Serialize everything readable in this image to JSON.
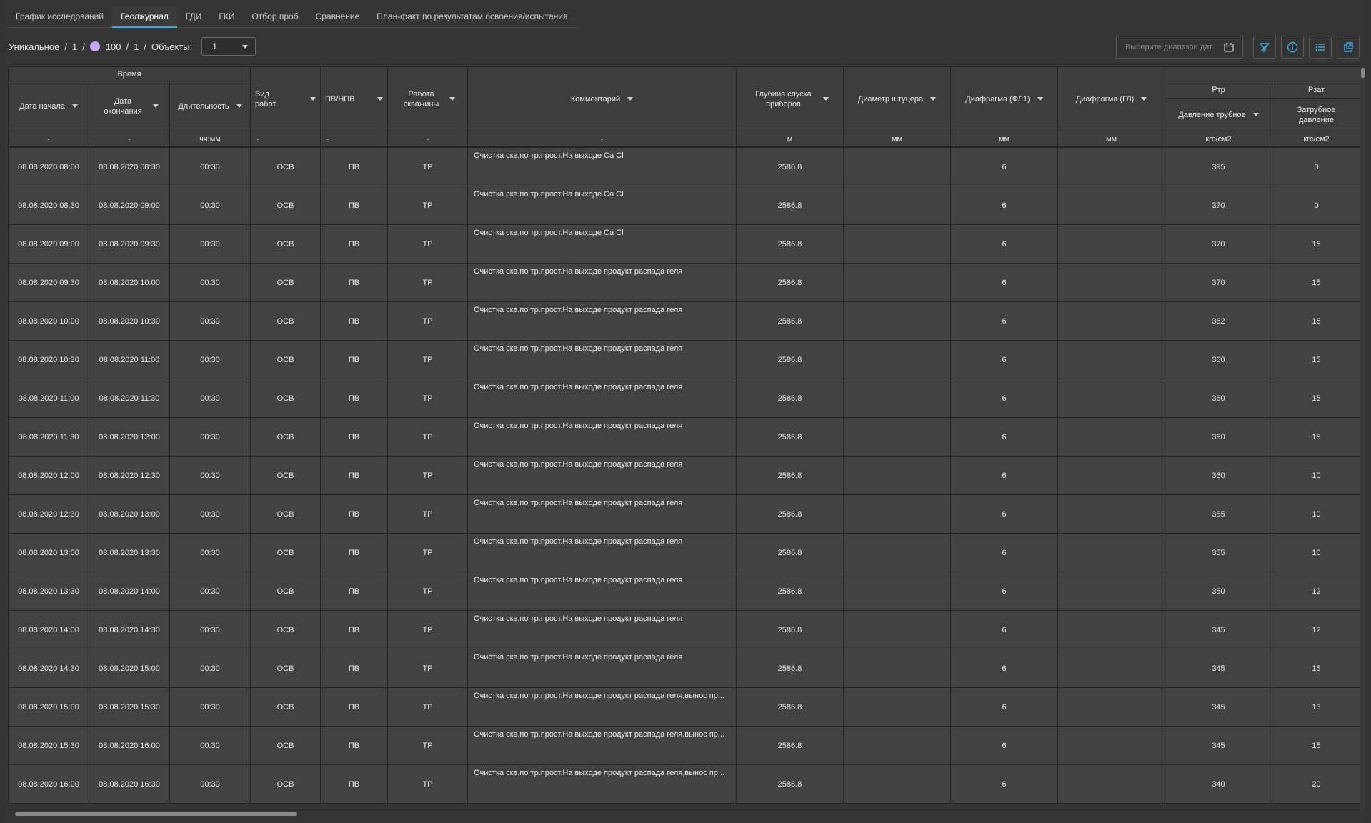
{
  "tabs": [
    {
      "label": "График исследований",
      "active": false
    },
    {
      "label": "Геолжурнал",
      "active": true
    },
    {
      "label": "ГДИ",
      "active": false
    },
    {
      "label": "ГКИ",
      "active": false
    },
    {
      "label": "Отбор проб",
      "active": false
    },
    {
      "label": "Сравнение",
      "active": false
    },
    {
      "label": "План-факт по результатам освоения/испытания",
      "active": false
    }
  ],
  "toolbar": {
    "unique_label": "Уникальное",
    "sep": "/",
    "val1": "1",
    "status_value": "100",
    "val2": "1",
    "objects_label": "Объекты:",
    "objects_value": "1",
    "date_placeholder": "Выберите диапазон дат"
  },
  "table": {
    "group_time": "Время",
    "group_ptr": "Ртр",
    "group_pzat": "Рзат",
    "headers": {
      "start": "Дата начала",
      "end": "Дата окончания",
      "duration": "Длительность",
      "work_type": "Вид работ",
      "pv": "ПВ/НПВ",
      "well_work": "Работа скважины",
      "comment": "Комментарий",
      "depth": "Глубина спуска приборов",
      "choke": "Диаметр штуцера",
      "diaph_fl": "Диафрагма (ФЛ1)",
      "diaph_gl": "Диафрагма (ГЛ)",
      "tube_pressure": "Давление трубное",
      "annular_pressure": "Затрубное давление"
    },
    "units": [
      "-",
      "-",
      "чч:мм",
      "-",
      "-",
      "-",
      "-",
      "м",
      "мм",
      "мм",
      "мм",
      "кгс/см2",
      "кгс/см2"
    ],
    "rows": [
      [
        "08.08.2020 08:00",
        "08.08.2020 08:30",
        "00:30",
        "ОСВ",
        "ПВ",
        "ТР",
        "Очистка скв.по тр.прост.На выходе Са Cl",
        "2586.8",
        "",
        "6",
        "",
        "395",
        "0"
      ],
      [
        "08.08.2020 08:30",
        "08.08.2020 09:00",
        "00:30",
        "ОСВ",
        "ПВ",
        "ТР",
        "Очистка скв.по тр.прост.На выходе Са Cl",
        "2586.8",
        "",
        "6",
        "",
        "370",
        "0"
      ],
      [
        "08.08.2020 09:00",
        "08.08.2020 09:30",
        "00:30",
        "ОСВ",
        "ПВ",
        "ТР",
        "Очистка скв.по тр.прост.На выходе Са Cl",
        "2586.8",
        "",
        "6",
        "",
        "370",
        "15"
      ],
      [
        "08.08.2020 09:30",
        "08.08.2020 10:00",
        "00:30",
        "ОСВ",
        "ПВ",
        "ТР",
        "Очистка скв.по тр.прост.На выходе продукт распада геля",
        "2586.8",
        "",
        "6",
        "",
        "370",
        "15"
      ],
      [
        "08.08.2020 10:00",
        "08.08.2020 10:30",
        "00:30",
        "ОСВ",
        "ПВ",
        "ТР",
        "Очистка скв.по тр.прост.На выходе продукт распада геля",
        "2586.8",
        "",
        "6",
        "",
        "362",
        "15"
      ],
      [
        "08.08.2020 10:30",
        "08.08.2020 11:00",
        "00:30",
        "ОСВ",
        "ПВ",
        "ТР",
        "Очистка скв.по тр.прост.На выходе продукт распада геля",
        "2586.8",
        "",
        "6",
        "",
        "360",
        "15"
      ],
      [
        "08.08.2020 11:00",
        "08.08.2020 11:30",
        "00:30",
        "ОСВ",
        "ПВ",
        "ТР",
        "Очистка скв.по тр.прост.На выходе продукт распада геля",
        "2586.8",
        "",
        "6",
        "",
        "360",
        "15"
      ],
      [
        "08.08.2020 11:30",
        "08.08.2020 12:00",
        "00:30",
        "ОСВ",
        "ПВ",
        "ТР",
        "Очистка скв.по тр.прост.На выходе продукт распада геля",
        "2586.8",
        "",
        "6",
        "",
        "360",
        "15"
      ],
      [
        "08.08.2020 12:00",
        "08.08.2020 12:30",
        "00:30",
        "ОСВ",
        "ПВ",
        "ТР",
        "Очистка скв.по тр.прост.На выходе продукт распада геля",
        "2586.8",
        "",
        "6",
        "",
        "360",
        "10"
      ],
      [
        "08.08.2020 12:30",
        "08.08.2020 13:00",
        "00:30",
        "ОСВ",
        "ПВ",
        "ТР",
        "Очистка скв.по тр.прост.На выходе продукт распада геля",
        "2586.8",
        "",
        "6",
        "",
        "355",
        "10"
      ],
      [
        "08.08.2020 13:00",
        "08.08.2020 13:30",
        "00:30",
        "ОСВ",
        "ПВ",
        "ТР",
        "Очистка скв.по тр.прост.На выходе продукт распада геля",
        "2586.8",
        "",
        "6",
        "",
        "355",
        "10"
      ],
      [
        "08.08.2020 13:30",
        "08.08.2020 14:00",
        "00:30",
        "ОСВ",
        "ПВ",
        "ТР",
        "Очистка скв.по тр.прост.На выходе продукт распада геля",
        "2586.8",
        "",
        "6",
        "",
        "350",
        "12"
      ],
      [
        "08.08.2020 14:00",
        "08.08.2020 14:30",
        "00:30",
        "ОСВ",
        "ПВ",
        "ТР",
        "Очистка скв.по тр.прост.На выходе продукт распада геля",
        "2586.8",
        "",
        "6",
        "",
        "345",
        "12"
      ],
      [
        "08.08.2020 14:30",
        "08.08.2020 15:00",
        "00:30",
        "ОСВ",
        "ПВ",
        "ТР",
        "Очистка скв.по тр.прост.На выходе продукт распада геля",
        "2586.8",
        "",
        "6",
        "",
        "345",
        "15"
      ],
      [
        "08.08.2020 15:00",
        "08.08.2020 15:30",
        "00:30",
        "ОСВ",
        "ПВ",
        "ТР",
        "Очистка скв.по тр.прост.На выходе продукт распада геля,вынос пр...",
        "2586.8",
        "",
        "6",
        "",
        "345",
        "13"
      ],
      [
        "08.08.2020 15:30",
        "08.08.2020 16:00",
        "00:30",
        "ОСВ",
        "ПВ",
        "ТР",
        "Очистка скв.по тр.прост.На выходе продукт распада геля,вынос пр...",
        "2586.8",
        "",
        "6",
        "",
        "345",
        "15"
      ],
      [
        "08.08.2020 16:00",
        "08.08.2020 16:30",
        "00:30",
        "ОСВ",
        "ПВ",
        "ТР",
        "Очистка скв.по тр.прост.На выходе продукт распада геля,вынос пр...",
        "2586.8",
        "",
        "6",
        "",
        "340",
        "20"
      ]
    ]
  },
  "colors": {
    "accent": "#3fa9dd",
    "status_dot": "#c9a6f0"
  },
  "icons": [
    "calendar-icon",
    "filter-off-icon",
    "info-icon",
    "list-icon",
    "export-icon",
    "caret-down-icon"
  ]
}
